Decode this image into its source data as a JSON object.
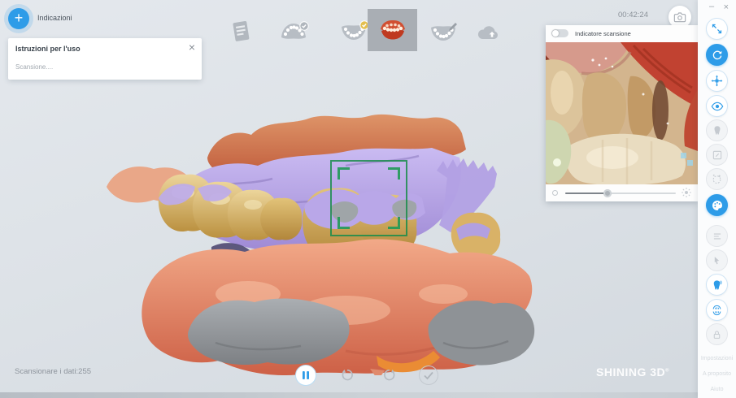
{
  "icons": {
    "plus": "+",
    "close": "×",
    "minimize": "–"
  },
  "header": {
    "title": "Indicazioni",
    "timer": "00:42:24"
  },
  "toolbar": {
    "items": [
      "report-form",
      "upper-arch-done",
      "lower-arch-done",
      "occlusion-selected",
      "edit-arch",
      "cloud-upload"
    ]
  },
  "instructions_panel": {
    "title": "Istruzioni per l'uso",
    "body": "Scansione...."
  },
  "camera_panel": {
    "toggle_label": "Indicatore scansione",
    "toggle_state": "off",
    "brightness_position": "38%"
  },
  "statusbar": {
    "scan_counter": "Scansionare i dati:255"
  },
  "playback": {
    "buttons": [
      "pause",
      "rotate-left",
      "rotate-right",
      "confirm"
    ]
  },
  "branding": {
    "logo": "SHINING 3D",
    "mark": "®"
  },
  "sidebar": {
    "links": [
      "Impostazioni",
      "A proposito",
      "Aiuto"
    ],
    "tools": [
      "zoom-fit",
      "rotate-view",
      "pan-view",
      "view-eye",
      "tooth",
      "edit-region",
      "ai-refine",
      "palette-texture",
      "annotation",
      "cursor-select",
      "tooth-scan",
      "occlusion-check",
      "lock"
    ]
  },
  "colors": {
    "accent": "#2e9ce8",
    "scanbox_green": "#1f9c55",
    "selected_tile": "#a9aeb4",
    "mesh_gum": "#e0906c",
    "mesh_tooth": "#d8b96a",
    "mesh_overlay": "#b5a3e3",
    "mesh_gray": "#94989c"
  }
}
